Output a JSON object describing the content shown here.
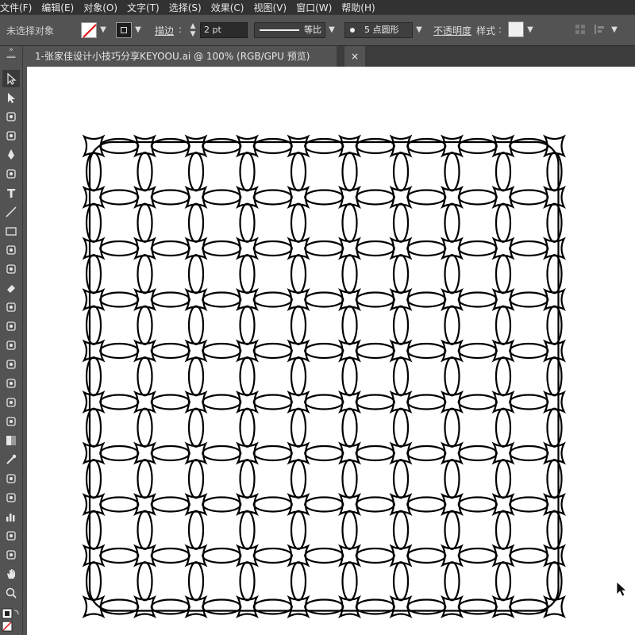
{
  "menu": [
    {
      "label": "文件(F)"
    },
    {
      "label": "编辑(E)"
    },
    {
      "label": "对象(O)"
    },
    {
      "label": "文字(T)"
    },
    {
      "label": "选择(S)"
    },
    {
      "label": "效果(C)"
    },
    {
      "label": "视图(V)"
    },
    {
      "label": "窗口(W)"
    },
    {
      "label": "帮助(H)"
    }
  ],
  "control_bar": {
    "selection_status": "未选择对象",
    "stroke_label": "描边",
    "stroke_colon": ":",
    "stroke_weight": "2 pt",
    "profile_label": "等比",
    "brush_label": "5 点圆形",
    "opacity_label": "不透明度",
    "style_label": "样式",
    "style_colon": ":"
  },
  "document": {
    "tab_title": "1-张家佳设计小技巧分享KEYOOU.ai @ 100% (RGB/GPU 预览)",
    "close_glyph": "×"
  },
  "toolbar": {
    "tools": [
      "selection-tool-icon",
      "direct-selection-tool-icon",
      "magic-wand-tool-icon",
      "lasso-tool-icon",
      "pen-tool-icon",
      "curvature-tool-icon",
      "type-tool-icon",
      "line-tool-icon",
      "rectangle-tool-icon",
      "paintbrush-tool-icon",
      "shaper-tool-icon",
      "eraser-tool-icon",
      "rotate-tool-icon",
      "scale-tool-icon",
      "width-tool-icon",
      "free-transform-tool-icon",
      "shape-builder-tool-icon",
      "perspective-grid-tool-icon",
      "mesh-tool-icon",
      "gradient-tool-icon",
      "eyedropper-tool-icon",
      "blend-tool-icon",
      "symbol-sprayer-tool-icon",
      "column-graph-tool-icon",
      "artboard-tool-icon",
      "slice-tool-icon",
      "hand-tool-icon",
      "zoom-tool-icon"
    ],
    "active_tool": "selection-tool-icon"
  },
  "colors": {
    "ui_dark": "#323232",
    "ui_mid": "#535353",
    "artboard": "#ffffff",
    "artwork_stroke": "#000000"
  }
}
